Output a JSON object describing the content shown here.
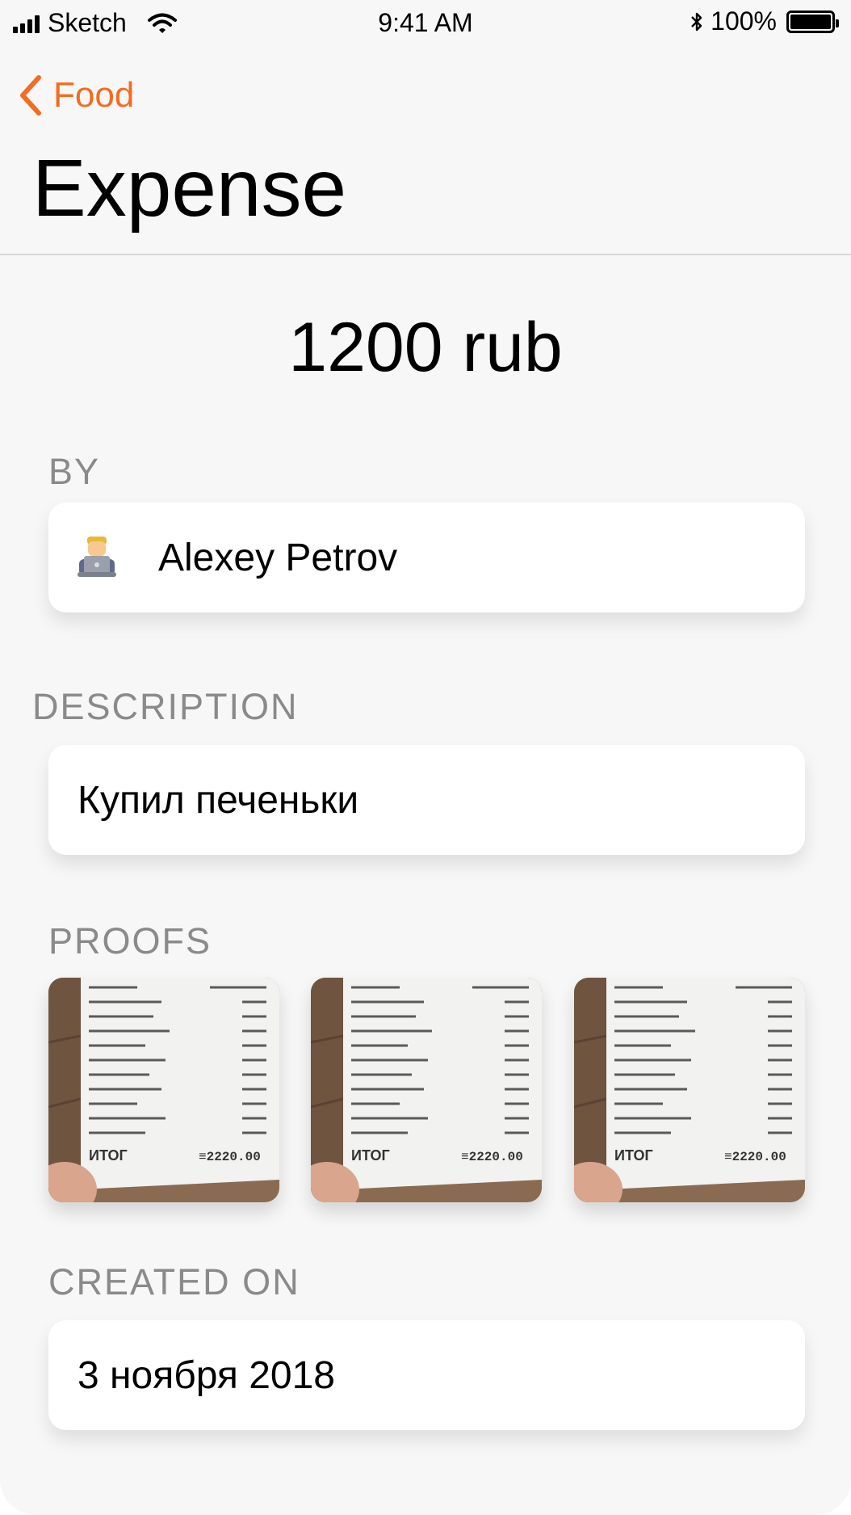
{
  "status_bar": {
    "carrier": "Sketch",
    "time": "9:41 AM",
    "battery_percent": "100%",
    "battery_level": 1.0
  },
  "nav": {
    "back_label": "Food",
    "title": "Expense",
    "accent_color": "#f36c21"
  },
  "expense": {
    "amount": "1200 rub"
  },
  "sections": {
    "by": {
      "label": "BY",
      "name": "Alexey Petrov",
      "avatar_icon": "technologist-emoji-icon"
    },
    "description": {
      "label": "DESCRIPTION",
      "text": "Купил печеньки"
    },
    "proofs": {
      "label": "PROOFS",
      "images": [
        {
          "icon": "receipt-photo",
          "total_text": "ИТОГ",
          "total_value": "≡2220.00"
        },
        {
          "icon": "receipt-photo",
          "total_text": "ИТОГ",
          "total_value": "≡2220.00"
        },
        {
          "icon": "receipt-photo",
          "total_text": "ИТОГ",
          "total_value": "≡2220.00"
        }
      ]
    },
    "created_on": {
      "label": "CREATED ON",
      "date": "3 ноября 2018"
    }
  }
}
